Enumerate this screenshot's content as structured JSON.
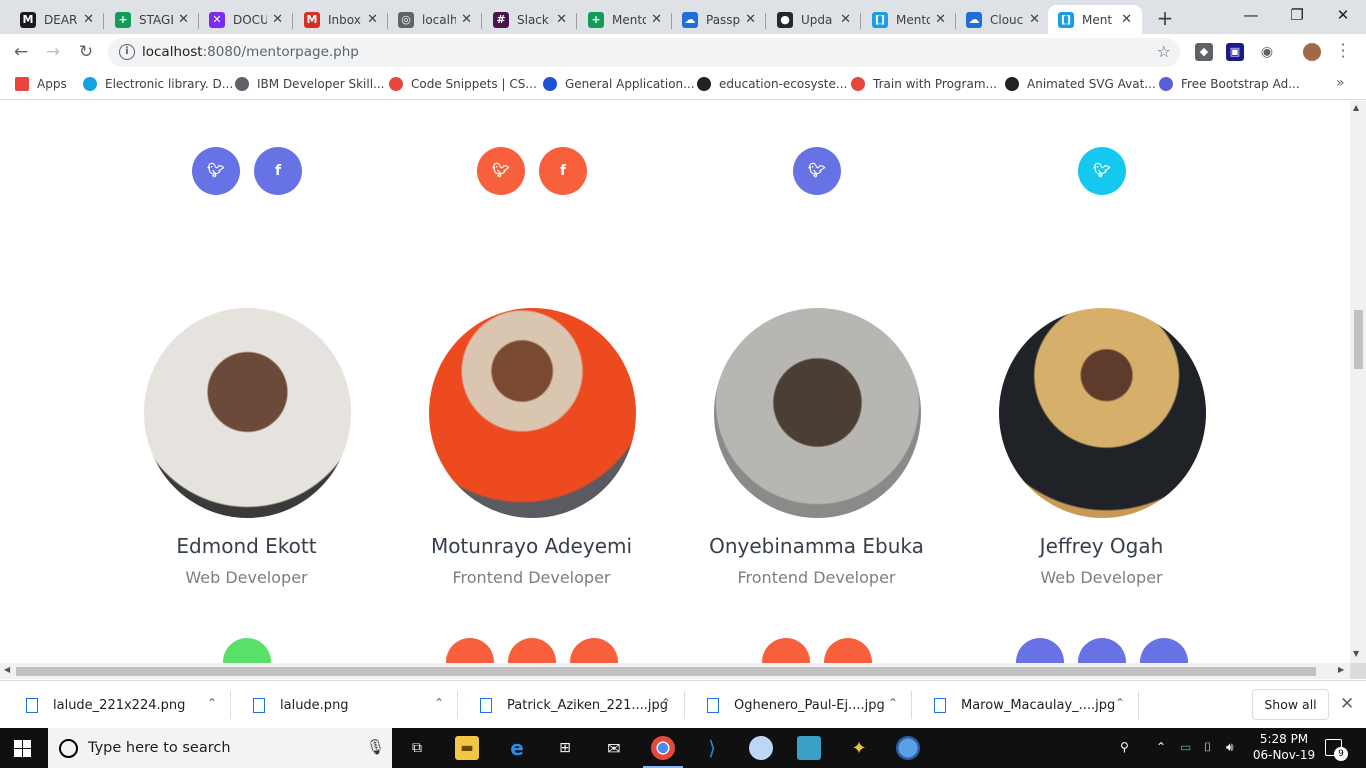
{
  "browser": {
    "tabs": [
      {
        "title": "DEAR",
        "favicon": "M",
        "color": "#1a1a1a"
      },
      {
        "title": "STAGE",
        "favicon": "+",
        "color": "#0f9d58"
      },
      {
        "title": "DOCU",
        "favicon": "✕",
        "color": "#7b2cf0"
      },
      {
        "title": "Inbox",
        "favicon": "M",
        "color": "#d93025"
      },
      {
        "title": "localh",
        "favicon": "◎",
        "color": "#5f6368"
      },
      {
        "title": "Slack",
        "favicon": "#",
        "color": "#4a154b"
      },
      {
        "title": "Mento",
        "favicon": "+",
        "color": "#0f9d58"
      },
      {
        "title": "Passp",
        "favicon": "☁",
        "color": "#1e6fd9"
      },
      {
        "title": "Upda",
        "favicon": "●",
        "color": "#24292e"
      },
      {
        "title": "Mento",
        "favicon": "[]",
        "color": "#1a9ee2"
      },
      {
        "title": "Clouc",
        "favicon": "☁",
        "color": "#1e6fd9"
      },
      {
        "title": "Ment",
        "favicon": "[]",
        "color": "#1a9ee2"
      }
    ],
    "url_host": "localhost",
    "url_path": ":8080/mentorpage.php",
    "bookmarks": [
      {
        "label": "Apps",
        "color": "#e8453c"
      },
      {
        "label": "Electronic library. D...",
        "color": "#13a3e0"
      },
      {
        "label": "IBM Developer Skill...",
        "color": "#5f6368"
      },
      {
        "label": "Code Snippets | CS...",
        "color": "#e8453c"
      },
      {
        "label": "General Application...",
        "color": "#1e4fd9"
      },
      {
        "label": "education-ecosyste...",
        "color": "#222222"
      },
      {
        "label": "Train with Program...",
        "color": "#e8453c"
      },
      {
        "label": "Animated SVG Avat...",
        "color": "#222222"
      },
      {
        "label": "Free Bootstrap Ad...",
        "color": "#5a5fd9"
      }
    ]
  },
  "colors": {
    "twitter_purple": "#6772e5",
    "orange": "#f75f3d",
    "cyan": "#14c8ef",
    "green": "#58e06b"
  },
  "mentors": [
    {
      "name": "Edmond Ekott",
      "role": "Web Developer"
    },
    {
      "name": "Motunrayo Adeyemi",
      "role": "Frontend Developer"
    },
    {
      "name": "Onyebinamma Ebuka",
      "role": "Frontend Developer"
    },
    {
      "name": "Jeffrey Ogah",
      "role": "Web Developer"
    }
  ],
  "downloads": {
    "items": [
      "lalude_221x224.png",
      "lalude.png",
      "Patrick_Aziken_221....jpg",
      "Oghenero_Paul-Ej....jpg",
      "Marow_Macaulay_....jpg"
    ],
    "show_all": "Show all"
  },
  "taskbar": {
    "search_placeholder": "Type here to search",
    "time": "5:28 PM",
    "date": "06-Nov-19",
    "notification_count": "9"
  }
}
